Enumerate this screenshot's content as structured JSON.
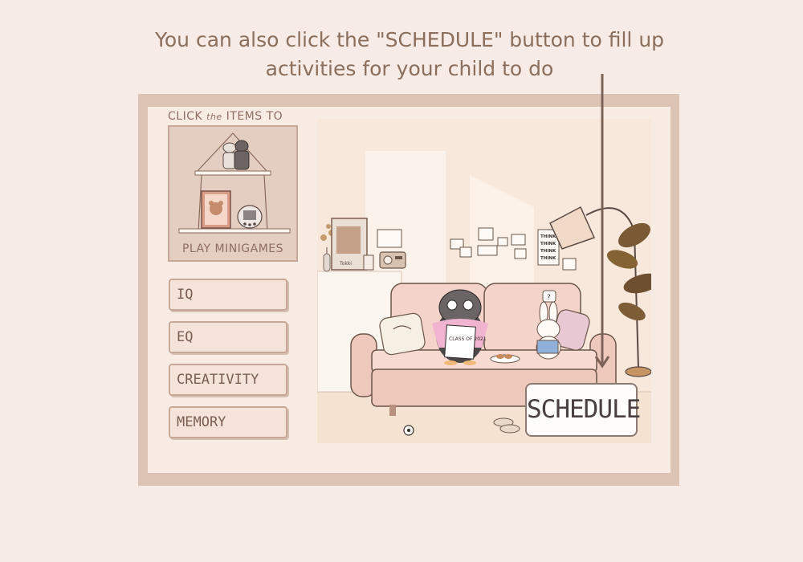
{
  "caption": {
    "line1": "You can also click the \"SCHEDULE\" button to fill up",
    "line2": "activities for your child to do"
  },
  "minigames": {
    "title_part1": "CLICK",
    "title_part2": "the",
    "title_part3": "ITEMS TO",
    "label": "PLAY MINIGAMES"
  },
  "categories": [
    {
      "label": "IQ"
    },
    {
      "label": "EQ"
    },
    {
      "label": "CREATIVITY"
    },
    {
      "label": "MEMORY"
    }
  ],
  "room": {
    "character_shirt_text": "CLASS OF 2021",
    "poster_text": "THINK THINK THINK THINK",
    "photo_label": "Tokki",
    "speech_bubble": "?"
  },
  "schedule_button": {
    "label": "SCHEDULE"
  },
  "colors": {
    "background": "#f6ebe6",
    "caption": "#8b6e5b",
    "frame": "#dcc3b4",
    "inner": "#f8ebe3",
    "arrow": "#7d6357",
    "sofa": "#f0cdc4"
  }
}
